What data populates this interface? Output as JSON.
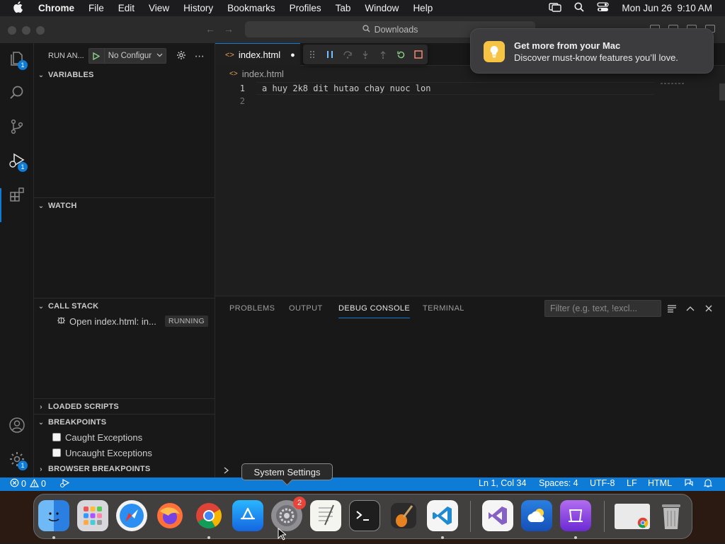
{
  "menubar": {
    "items": [
      "Chrome",
      "File",
      "Edit",
      "View",
      "History",
      "Bookmarks",
      "Profiles",
      "Tab",
      "Window",
      "Help"
    ],
    "datetime": "Mon Jun 26  9:10 AM"
  },
  "browser": {
    "address": "Downloads"
  },
  "notification": {
    "title": "Get more from your Mac",
    "body": "Discover must-know features you’ll love.",
    "icon": "lightbulb-icon"
  },
  "activity_bar": {
    "explorer_badge": "1",
    "debug_badge": "1",
    "settings_badge": "1"
  },
  "sidebar": {
    "run_label": "RUN AN...",
    "config": "No Configur",
    "variables": "VARIABLES",
    "watch": "WATCH",
    "call_stack": "CALL STACK",
    "call_stack_item": "Open index.html: in...",
    "call_stack_status": "RUNNING",
    "loaded_scripts": "LOADED SCRIPTS",
    "breakpoints": "BREAKPOINTS",
    "caught": "Caught Exceptions",
    "uncaught": "Uncaught Exceptions",
    "browser_breakpoints": "BROWSER BREAKPOINTS"
  },
  "editor": {
    "tab_label": "index.html",
    "breadcrumb": "index.html",
    "lines": [
      {
        "num": "1",
        "text": "a huy 2k8 dit hutao chay nuoc lon"
      },
      {
        "num": "2",
        "text": ""
      }
    ]
  },
  "panel": {
    "tabs": [
      "PROBLEMS",
      "OUTPUT",
      "DEBUG CONSOLE",
      "TERMINAL"
    ],
    "active_tab": "DEBUG CONSOLE",
    "filter_placeholder": "Filter (e.g. text, !excl..."
  },
  "tooltip": "System Settings",
  "statusbar": {
    "errors": "0",
    "warnings": "0",
    "position": "Ln 1, Col 34",
    "spaces": "Spaces: 4",
    "encoding": "UTF-8",
    "eol": "LF",
    "language": "HTML"
  },
  "dock": {
    "settings_badge": "2"
  },
  "colors": {
    "accent": "#0e7bd6",
    "status_bar": "#0e7bd6",
    "badge_red": "#e9443a"
  }
}
